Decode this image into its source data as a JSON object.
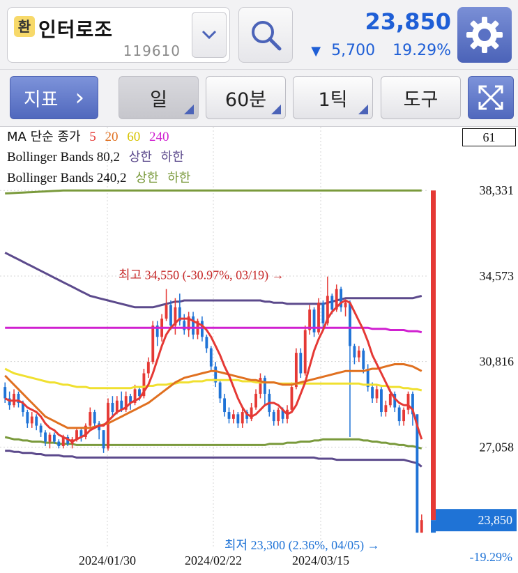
{
  "header": {
    "badge": "환",
    "stock_name": "인터로조",
    "stock_code": "119610",
    "price": "23,850",
    "change_arrow": "▼",
    "change_amount": "5,700",
    "change_percent": "19.29%",
    "icons": {
      "dropdown": "chevron-down-icon",
      "search": "search-icon",
      "settings": "gear-icon"
    }
  },
  "toolbar": {
    "indicator_label": "지표",
    "indicator_arrow": "›",
    "period_day": "일",
    "period_minute": "60분",
    "period_tick": "1틱",
    "tools": "도구",
    "expand_icon": "expand-icon"
  },
  "legend": {
    "ma_label": "MA 단순 종가",
    "ma_periods": [
      {
        "value": "5",
        "color": "#e53935"
      },
      {
        "value": "20",
        "color": "#e07020"
      },
      {
        "value": "60",
        "color": "#e8d800"
      },
      {
        "value": "240",
        "color": "#d020d0"
      }
    ],
    "bb1_label": "Bollinger Bands 80,2",
    "bb1_upper": "상한",
    "bb1_lower": "하한",
    "bb1_color": "#5c4a8c",
    "bb2_label": "Bollinger Bands 240,2",
    "bb2_upper": "상한",
    "bb2_lower": "하한",
    "bb2_color": "#7a9a3c",
    "box_value": "61"
  },
  "chart_data": {
    "type": "candlestick",
    "ylim": [
      22600,
      39900
    ],
    "y_ticks": [
      "38,331",
      "34,573",
      "30,816",
      "27,058"
    ],
    "x_labels": [
      "2024/01/30",
      "2024/02/22",
      "2024/03/15"
    ],
    "current_price_label": "23,850",
    "current_change_label": "-19.29%",
    "high_annotation": "최고 34,550 (-30.97%, 03/19) →",
    "low_annotation": "최저 23,300 (2.36%, 04/05) →",
    "colors": {
      "up": "#e53935",
      "down": "#1f73d6",
      "ma5": "#e53935",
      "ma20": "#e07020",
      "ma60": "#f0e030",
      "ma240": "#d020d0",
      "bb80": "#5c4a8c",
      "bb240": "#7a9a3c",
      "price_tag": "#1f73d6"
    },
    "candles": [
      [
        29700,
        29200,
        29900,
        29000
      ],
      [
        29200,
        28900,
        29500,
        28700
      ],
      [
        28900,
        29400,
        29600,
        28800
      ],
      [
        29400,
        29000,
        29500,
        28800
      ],
      [
        29000,
        28600,
        29100,
        28400
      ],
      [
        28600,
        28100,
        28700,
        27900
      ],
      [
        28100,
        28400,
        28600,
        27900
      ],
      [
        28400,
        28000,
        28500,
        27800
      ],
      [
        28000,
        27700,
        28100,
        27500
      ],
      [
        27700,
        27300,
        27800,
        27100
      ],
      [
        27300,
        27600,
        27700,
        27000
      ],
      [
        27600,
        27300,
        27700,
        27200
      ],
      [
        27300,
        27100,
        27400,
        27000
      ],
      [
        27100,
        27500,
        27600,
        27000
      ],
      [
        27500,
        27200,
        27600,
        27100
      ],
      [
        27200,
        27400,
        27500,
        27000
      ],
      [
        27400,
        27800,
        27900,
        27300
      ],
      [
        27800,
        27500,
        27900,
        27300
      ],
      [
        27500,
        28000,
        28100,
        27400
      ],
      [
        28000,
        28600,
        28800,
        27900
      ],
      [
        28600,
        28100,
        28700,
        27900
      ],
      [
        28100,
        27800,
        28200,
        27400
      ],
      [
        27800,
        27000,
        27800,
        26800
      ],
      [
        27000,
        29000,
        29200,
        26900
      ],
      [
        29000,
        28600,
        29300,
        28400
      ],
      [
        28600,
        29100,
        29300,
        28500
      ],
      [
        29100,
        28700,
        29500,
        28600
      ],
      [
        28700,
        29300,
        29500,
        28600
      ],
      [
        29300,
        29000,
        29400,
        28700
      ],
      [
        29000,
        29600,
        29800,
        28900
      ],
      [
        29600,
        29300,
        29700,
        29100
      ],
      [
        29300,
        30300,
        30500,
        29200
      ],
      [
        30300,
        30800,
        31000,
        30100
      ],
      [
        30800,
        32400,
        32600,
        30700
      ],
      [
        32400,
        31900,
        32600,
        31500
      ],
      [
        31900,
        32700,
        32900,
        31700
      ],
      [
        32700,
        33300,
        34000,
        32600
      ],
      [
        33300,
        32400,
        33500,
        32200
      ],
      [
        32400,
        33200,
        33600,
        32000
      ],
      [
        33200,
        32600,
        33800,
        32400
      ],
      [
        32600,
        32200,
        32900,
        32000
      ],
      [
        32200,
        32800,
        33000,
        31900
      ],
      [
        32800,
        32000,
        33000,
        31800
      ],
      [
        32000,
        32600,
        32700,
        31800
      ],
      [
        32600,
        31900,
        32800,
        31700
      ],
      [
        31900,
        31400,
        32000,
        31200
      ],
      [
        31400,
        30600,
        31500,
        30400
      ],
      [
        30600,
        29900,
        30800,
        29700
      ],
      [
        29900,
        29200,
        30000,
        29000
      ],
      [
        29200,
        28600,
        29400,
        28400
      ],
      [
        28600,
        28300,
        28800,
        28100
      ],
      [
        28300,
        28500,
        28700,
        28100
      ],
      [
        28500,
        28100,
        28600,
        27900
      ],
      [
        28100,
        28600,
        28800,
        27900
      ],
      [
        28600,
        28300,
        28700,
        28100
      ],
      [
        28300,
        28800,
        29000,
        28200
      ],
      [
        28800,
        29400,
        29600,
        28700
      ],
      [
        29400,
        30100,
        30300,
        29200
      ],
      [
        30100,
        29400,
        30200,
        28900
      ],
      [
        29400,
        28600,
        29600,
        28400
      ],
      [
        28600,
        28200,
        28700,
        28000
      ],
      [
        28200,
        28700,
        28800,
        28000
      ],
      [
        28700,
        28300,
        28800,
        28100
      ],
      [
        28300,
        28700,
        28900,
        28100
      ],
      [
        28700,
        29700,
        29900,
        28600
      ],
      [
        29700,
        31200,
        31400,
        29600
      ],
      [
        31200,
        30300,
        31400,
        30100
      ],
      [
        30300,
        32200,
        32400,
        30200
      ],
      [
        32200,
        33100,
        33300,
        32000
      ],
      [
        33100,
        32100,
        33200,
        31900
      ],
      [
        32100,
        33400,
        33600,
        32000
      ],
      [
        33400,
        32500,
        33500,
        32300
      ],
      [
        32500,
        33700,
        34550,
        32400
      ],
      [
        33700,
        33100,
        33800,
        32900
      ],
      [
        33100,
        34000,
        34200,
        33000
      ],
      [
        34000,
        33200,
        34100,
        33000
      ],
      [
        33200,
        33400,
        33500,
        32800
      ],
      [
        33400,
        31500,
        33500,
        27500
      ],
      [
        31500,
        31000,
        31600,
        30700
      ],
      [
        31000,
        31300,
        31500,
        30800
      ],
      [
        31300,
        30500,
        31400,
        30300
      ],
      [
        30500,
        29700,
        30700,
        29500
      ],
      [
        29700,
        29200,
        29900,
        29000
      ],
      [
        29200,
        29600,
        29800,
        29000
      ],
      [
        29600,
        28600,
        29700,
        28400
      ],
      [
        28600,
        28900,
        29100,
        28400
      ],
      [
        28900,
        29400,
        29600,
        28800
      ],
      [
        29400,
        28800,
        29500,
        28600
      ],
      [
        28800,
        28200,
        28900,
        28000
      ],
      [
        28200,
        28700,
        28800,
        28000
      ],
      [
        28700,
        29400,
        29500,
        28500
      ],
      [
        29400,
        28500,
        29500,
        28000
      ],
      [
        28500,
        23300,
        28500,
        23300
      ],
      [
        23300,
        23850,
        24100,
        23300
      ]
    ],
    "ma5": [
      29200,
      29100,
      29100,
      29100,
      29000,
      28800,
      28700,
      28600,
      28400,
      28100,
      27900,
      27800,
      27600,
      27500,
      27400,
      27300,
      27400,
      27500,
      27600,
      27800,
      27900,
      28000,
      28000,
      28200,
      28400,
      28600,
      28700,
      28800,
      29000,
      29100,
      29200,
      29500,
      29800,
      30300,
      30900,
      31500,
      32000,
      32300,
      32500,
      32700,
      32700,
      32700,
      32600,
      32500,
      32400,
      32200,
      31900,
      31500,
      31100,
      30600,
      30200,
      29700,
      29200,
      28800,
      28500,
      28400,
      28500,
      28700,
      28900,
      29000,
      29000,
      28900,
      28700,
      28500,
      28600,
      28900,
      29400,
      29900,
      30600,
      31300,
      31800,
      32200,
      32700,
      33000,
      33200,
      33400,
      33500,
      33400,
      33000,
      32600,
      32200,
      31700,
      31100,
      30700,
      30300,
      29900,
      29500,
      29200,
      29000,
      28900,
      28900,
      28700,
      28000,
      27400
    ],
    "ma20": [
      30200,
      30000,
      29800,
      29600,
      29400,
      29200,
      29000,
      28800,
      28600,
      28400,
      28300,
      28200,
      28100,
      28000,
      27900,
      27900,
      27900,
      27900,
      27900,
      27900,
      27950,
      28000,
      28050,
      28100,
      28200,
      28300,
      28400,
      28500,
      28600,
      28700,
      28800,
      28900,
      29000,
      29150,
      29300,
      29450,
      29600,
      29750,
      29900,
      30000,
      30100,
      30150,
      30200,
      30250,
      30300,
      30350,
      30400,
      30400,
      30350,
      30300,
      30250,
      30200,
      30150,
      30100,
      30050,
      30000,
      30000,
      29950,
      29900,
      29900,
      29900,
      29850,
      29800,
      29800,
      29800,
      29850,
      29900,
      29950,
      30000,
      30050,
      30100,
      30150,
      30200,
      30250,
      30300,
      30350,
      30400,
      30400,
      30400,
      30400,
      30400,
      30450,
      30500,
      30500,
      30550,
      30600,
      30650,
      30700,
      30700,
      30700,
      30650,
      30600,
      30500,
      30400
    ],
    "ma60": [
      30500,
      30400,
      30300,
      30250,
      30200,
      30150,
      30100,
      30050,
      30000,
      29950,
      29900,
      29900,
      29850,
      29800,
      29800,
      29750,
      29700,
      29700,
      29700,
      29650,
      29650,
      29650,
      29650,
      29650,
      29650,
      29650,
      29650,
      29650,
      29650,
      29700,
      29700,
      29700,
      29750,
      29750,
      29800,
      29800,
      29800,
      29850,
      29850,
      29900,
      29900,
      29900,
      29950,
      29950,
      29950,
      30000,
      30000,
      30000,
      30000,
      30000,
      30000,
      30000,
      30000,
      29950,
      29950,
      29950,
      29900,
      29900,
      29900,
      29900,
      29900,
      29850,
      29850,
      29850,
      29850,
      29850,
      29850,
      29850,
      29850,
      29850,
      29850,
      29850,
      29850,
      29850,
      29850,
      29850,
      29850,
      29850,
      29850,
      29850,
      29800,
      29800,
      29800,
      29800,
      29750,
      29750,
      29700,
      29700,
      29700,
      29650,
      29650,
      29600,
      29600,
      29550
    ],
    "ma240": [
      32300,
      32300,
      32300,
      32300,
      32300,
      32300,
      32300,
      32300,
      32300,
      32300,
      32300,
      32300,
      32300,
      32300,
      32300,
      32300,
      32300,
      32300,
      32300,
      32300,
      32300,
      32300,
      32300,
      32300,
      32300,
      32300,
      32300,
      32300,
      32300,
      32300,
      32300,
      32300,
      32300,
      32300,
      32300,
      32300,
      32300,
      32300,
      32300,
      32300,
      32300,
      32300,
      32300,
      32300,
      32300,
      32300,
      32300,
      32300,
      32300,
      32300,
      32300,
      32300,
      32300,
      32300,
      32300,
      32300,
      32300,
      32300,
      32300,
      32300,
      32300,
      32300,
      32300,
      32300,
      32300,
      32300,
      32300,
      32300,
      32300,
      32300,
      32300,
      32300,
      32300,
      32300,
      32300,
      32300,
      32300,
      32300,
      32300,
      32300,
      32300,
      32300,
      32250,
      32250,
      32250,
      32250,
      32200,
      32200,
      32200,
      32200,
      32150,
      32150,
      32150,
      32100
    ],
    "bb80_upper": [
      35600,
      35500,
      35400,
      35300,
      35200,
      35100,
      35000,
      34900,
      34800,
      34700,
      34600,
      34500,
      34400,
      34300,
      34200,
      34100,
      34000,
      33900,
      33800,
      33700,
      33650,
      33600,
      33550,
      33500,
      33450,
      33400,
      33350,
      33300,
      33250,
      33200,
      33200,
      33200,
      33200,
      33200,
      33250,
      33300,
      33350,
      33400,
      33450,
      33450,
      33500,
      33500,
      33500,
      33500,
      33500,
      33500,
      33500,
      33500,
      33500,
      33500,
      33500,
      33500,
      33500,
      33500,
      33500,
      33500,
      33500,
      33500,
      33450,
      33450,
      33400,
      33400,
      33400,
      33350,
      33350,
      33350,
      33350,
      33350,
      33350,
      33350,
      33350,
      33350,
      33400,
      33450,
      33500,
      33550,
      33600,
      33600,
      33600,
      33600,
      33600,
      33600,
      33600,
      33600,
      33600,
      33600,
      33600,
      33600,
      33600,
      33600,
      33600,
      33600,
      33650,
      33700
    ],
    "bb80_lower": [
      26900,
      26900,
      26850,
      26850,
      26800,
      26800,
      26800,
      26750,
      26750,
      26700,
      26700,
      26700,
      26700,
      26650,
      26650,
      26650,
      26600,
      26600,
      26600,
      26600,
      26600,
      26600,
      26600,
      26600,
      26600,
      26600,
      26600,
      26600,
      26600,
      26600,
      26600,
      26600,
      26600,
      26600,
      26600,
      26600,
      26600,
      26600,
      26600,
      26600,
      26600,
      26600,
      26600,
      26600,
      26600,
      26600,
      26600,
      26600,
      26600,
      26600,
      26600,
      26600,
      26600,
      26600,
      26600,
      26600,
      26600,
      26600,
      26600,
      26600,
      26600,
      26600,
      26600,
      26600,
      26600,
      26600,
      26600,
      26600,
      26600,
      26600,
      26550,
      26550,
      26550,
      26550,
      26500,
      26500,
      26500,
      26500,
      26500,
      26500,
      26500,
      26500,
      26500,
      26500,
      26500,
      26500,
      26500,
      26500,
      26500,
      26500,
      26450,
      26400,
      26350,
      26200
    ],
    "bb240_upper": [
      38200,
      38210,
      38220,
      38230,
      38240,
      38250,
      38260,
      38270,
      38280,
      38290,
      38300,
      38310,
      38320,
      38330,
      38331,
      38331,
      38331,
      38331,
      38331,
      38331,
      38331,
      38331,
      38331,
      38331,
      38331,
      38331,
      38331,
      38331,
      38331,
      38331,
      38331,
      38331,
      38331,
      38331,
      38331,
      38331,
      38331,
      38331,
      38331,
      38331,
      38331,
      38331,
      38331,
      38331,
      38331,
      38331,
      38331,
      38331,
      38331,
      38331,
      38331,
      38331,
      38331,
      38331,
      38331,
      38331,
      38331,
      38331,
      38331,
      38331,
      38331,
      38331,
      38331,
      38331,
      38331,
      38331,
      38331,
      38331,
      38331,
      38331,
      38331,
      38331,
      38331,
      38331,
      38331,
      38331,
      38331,
      38331,
      38331,
      38331,
      38331,
      38331,
      38331,
      38331,
      38331,
      38331,
      38331,
      38331,
      38331,
      38331,
      38331,
      38331,
      38331,
      38331
    ],
    "bb240_lower": [
      27500,
      27450,
      27400,
      27400,
      27350,
      27350,
      27300,
      27300,
      27300,
      27250,
      27250,
      27250,
      27200,
      27200,
      27200,
      27200,
      27150,
      27150,
      27150,
      27150,
      27150,
      27150,
      27150,
      27150,
      27150,
      27150,
      27150,
      27150,
      27150,
      27150,
      27150,
      27150,
      27150,
      27150,
      27150,
      27150,
      27150,
      27150,
      27150,
      27150,
      27150,
      27150,
      27150,
      27150,
      27150,
      27150,
      27150,
      27150,
      27150,
      27150,
      27150,
      27150,
      27150,
      27150,
      27150,
      27150,
      27150,
      27150,
      27150,
      27200,
      27200,
      27200,
      27200,
      27250,
      27250,
      27250,
      27300,
      27300,
      27300,
      27350,
      27350,
      27400,
      27400,
      27400,
      27400,
      27400,
      27400,
      27400,
      27400,
      27400,
      27350,
      27350,
      27300,
      27300,
      27250,
      27250,
      27200,
      27200,
      27150,
      27150,
      27100,
      27100,
      27050,
      27000
    ]
  }
}
